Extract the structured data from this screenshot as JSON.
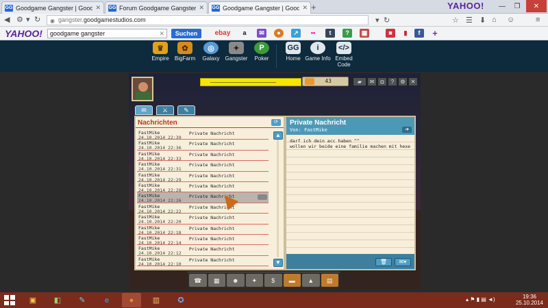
{
  "browser": {
    "tabs": [
      {
        "title": "Goodgame Gangster | Goodgame Gan...",
        "active": false
      },
      {
        "title": "Forum Goodgame Gangster | Goodg...",
        "active": false
      },
      {
        "title": "Goodgame Gangster | Goodgame Gan...",
        "active": true
      }
    ],
    "new_tab": "+",
    "url_prefix": "gangster.",
    "url_domain": "goodgamestudios.com",
    "yahoo_top": "YAHOO!"
  },
  "yahoo_toolbar": {
    "logo": "YAHOO!",
    "search_value": "goodgame gangster",
    "search_button": "Suchen",
    "items": [
      "ebay",
      "a",
      "mail",
      "ball",
      "chart",
      "flickr",
      "tumblr",
      "news",
      "cal",
      "sat",
      "bookmark",
      "f",
      "more"
    ]
  },
  "site_nav": {
    "games": [
      {
        "label": "Empire",
        "icon": "crown-icon",
        "color": "#e0a21c"
      },
      {
        "label": "BigFarm",
        "icon": "farm-icon",
        "color": "#d98a1d"
      },
      {
        "label": "Galaxy",
        "icon": "planet-icon",
        "color": "#5a9bd6"
      },
      {
        "label": "Gangster",
        "icon": "gun-icon",
        "color": "#8a8a8a"
      },
      {
        "label": "Poker",
        "icon": "poker-chip-icon",
        "color": "#3c9b3a"
      }
    ],
    "links": [
      {
        "label": "Home",
        "icon": "home-icon"
      },
      {
        "label": "Game Info",
        "icon": "info-icon"
      },
      {
        "label": "Embed Code",
        "icon": "code-icon"
      }
    ]
  },
  "game": {
    "coins": "43",
    "tabs": [
      "inbox",
      "write-off",
      "compose"
    ],
    "inbox_title": "Nachrichten",
    "messages": [
      {
        "from": "FastMike",
        "date": "24.10.2014 22:39",
        "subject": "Private Nachricht"
      },
      {
        "from": "FastMike",
        "date": "24.10.2014 22:36",
        "subject": "Private Nachricht"
      },
      {
        "from": "FastMike",
        "date": "24.10.2014 22:33",
        "subject": "Private Nachricht"
      },
      {
        "from": "FastMike",
        "date": "24.10.2014 22:31",
        "subject": "Private Nachricht"
      },
      {
        "from": "FastMike",
        "date": "24.10.2014 22:29",
        "subject": "Private Nachricht"
      },
      {
        "from": "FastMike",
        "date": "24.10.2014 22:28",
        "subject": "Private Nachricht"
      },
      {
        "from": "FastMike",
        "date": "24.10.2014 22:26",
        "subject": "Private Nachricht",
        "selected": true
      },
      {
        "from": "FastMike",
        "date": "24.10.2014 22:22",
        "subject": "Private Nachricht"
      },
      {
        "from": "FastMike",
        "date": "24.10.2014 22:20",
        "subject": "Private Nachricht"
      },
      {
        "from": "FastMike",
        "date": "24.10.2014 22:18",
        "subject": "Private Nachricht"
      },
      {
        "from": "FastMike",
        "date": "24.10.2014 22:14",
        "subject": "Private Nachricht"
      },
      {
        "from": "FastMike",
        "date": "24.10.2014 22:12",
        "subject": "Private Nachricht"
      },
      {
        "from": "FastMike",
        "date": "24.10.2014 22:10",
        "subject": "Private Nachricht"
      }
    ],
    "reader": {
      "title": "Private Nachricht",
      "from_label": "Von:",
      "from": "FastMike",
      "body": "darf ich dein acc haben ^^\nwollen wir beide eine familie machen mit hexe"
    }
  },
  "taskbar": {
    "apps": [
      "explorer-icon",
      "minecraft-icon",
      "paint-icon",
      "ie-icon",
      "firefox-icon",
      "archive-icon",
      "tool-icon"
    ],
    "time": "19:36",
    "date": "25.10.2014"
  },
  "colors": {
    "yahoo": "#5a1fa0",
    "site_header": "#0e2a3d",
    "taskbar": "#7a2b1c",
    "game_blue": "#4c98b7",
    "inbox_red": "#c2331f"
  }
}
